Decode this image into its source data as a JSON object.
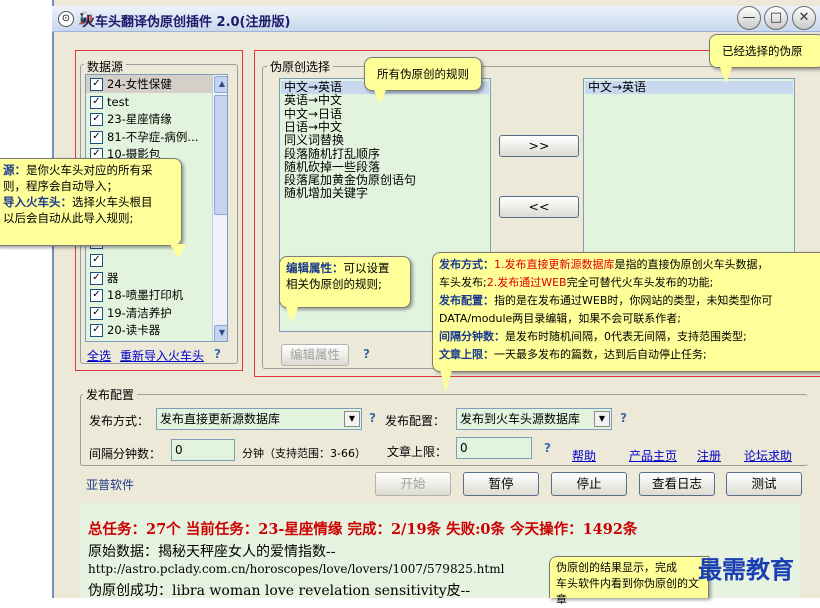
{
  "window": {
    "title": "火车头翻译伪原创插件 2.0(注册版)",
    "sys_glyph": "⊙",
    "minimize_glyph": "—",
    "maximize_glyph": "□",
    "close_glyph": "✕"
  },
  "datasource": {
    "title": "数据源",
    "items": [
      {
        "label": "24-女性保健",
        "checked": true
      },
      {
        "label": "test",
        "checked": true
      },
      {
        "label": "23-星座情缘",
        "checked": true
      },
      {
        "label": "81-不孕症-病例...",
        "checked": true
      },
      {
        "label": "10-摄影包",
        "checked": true
      },
      {
        "label": "",
        "checked": true
      },
      {
        "label": "",
        "checked": true
      },
      {
        "label": "",
        "checked": true
      },
      {
        "label": "",
        "checked": true
      },
      {
        "label": "",
        "checked": true
      },
      {
        "label": "",
        "checked": true
      },
      {
        "label": "器",
        "checked": true
      },
      {
        "label": "18-喷墨打印机",
        "checked": true
      },
      {
        "label": "19-清洁养护",
        "checked": true
      },
      {
        "label": "20-读卡器",
        "checked": true
      }
    ],
    "select_all": "全选",
    "reimport": "重新导入火车头",
    "help_q": "?"
  },
  "rules": {
    "title": "伪原创选择",
    "available": [
      "中文→英语",
      "英语→中文",
      "中文→日语",
      "日语→中文",
      "同义词替换",
      "段落随机打乱顺序",
      "随机砍掉一些段落",
      "段落尾加黄金伪原创语句",
      "随机增加关键字"
    ],
    "selected": [
      "中文→英语"
    ],
    "add_btn": ">>",
    "remove_btn": "<<",
    "edit_btn": "编辑属性",
    "help_q": "?"
  },
  "publish": {
    "title": "发布配置",
    "method_label": "发布方式：",
    "method_value": "发布直接更新源数据库",
    "config_label": "发布配置：",
    "config_value": "发布到火车头源数据库",
    "interval_label": "间隔分钟数：",
    "interval_value": "0",
    "interval_unit": "分钟（支持范围：3-66）",
    "limit_label": "文章上限：",
    "limit_value": "0",
    "help_q": "?",
    "links": {
      "help": "帮助",
      "home": "产品主页",
      "register": "注册",
      "forum": "论坛求助"
    }
  },
  "footer": {
    "brand": "亚普软件",
    "buttons": {
      "start": "开始",
      "pause": "暂停",
      "stop": "停止",
      "log": "查看日志",
      "test": "测试"
    }
  },
  "result": {
    "summary": "总任务：27个  当前任务：23-星座情缘  完成：2/19条  失败:0条  今天操作：1492条",
    "line1": "原始数据：揭秘天秤座女人的爱情指数--",
    "line2": "http://astro.pclady.com.cn/horoscopes/love/lovers/1007/579825.html",
    "line3": "伪原创成功：libra woman love revelation sensitivity皮--"
  },
  "tooltips": {
    "source_1_b": "源：",
    "source_1": "是你火车头对应的所有采",
    "source_2": "则，程序会自动导入；",
    "source_3_b": "导入火车头：",
    "source_3": "选择火车头根目",
    "source_4": "以后会自动从此导入规则;",
    "rules_all": "所有伪原创的规则",
    "selected_rules": "已经选择的伪原",
    "edit_b": "编辑属性：",
    "edit_1": "可以设置",
    "edit_2": "相关伪原创的规则;",
    "pub1_b": "发布方式：",
    "pub1_red": "1.发布直接更新源数据库",
    "pub1_rest": "是指的直接伪原创火车头数据，",
    "pub2_a": "车头发布;",
    "pub2_red": "2.发布通过WEB",
    "pub2_rest": "完全可替代火车头发布的功能;",
    "pub3_b": "发布配置：",
    "pub3": "指的是在发布通过WEB时，你网站的类型，未知类型你可",
    "pub4": "DATA/module两目录编辑，如果不会可联系作者;",
    "pub5_b": "间隔分钟数：",
    "pub5": "是发布时随机间隔，0代表无间隔，支持范围类型;",
    "pub6_b": "文章上限：",
    "pub6": "一天最多发布的篇数，达到后自动停止任务;",
    "result_1": "伪原创的结果显示，完成",
    "result_2": "车头软件内看到你伪原创的文章"
  },
  "watermark": "最需教育",
  "colors": {
    "list_bg": "#e3f4de",
    "red_frame": "#e03a3a",
    "tooltip": "#ffff99",
    "result_red": "#cc0000",
    "link": "#0000cc"
  }
}
